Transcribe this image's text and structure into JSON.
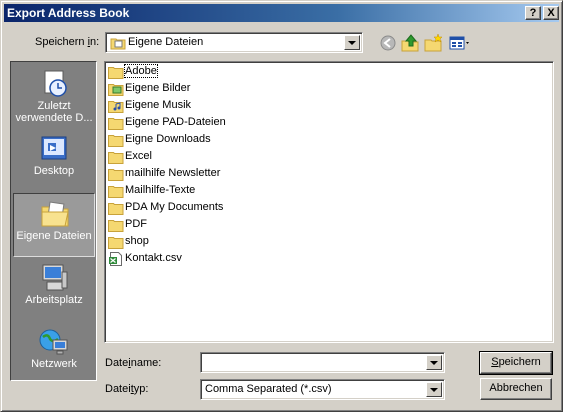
{
  "window": {
    "title": "Export Address Book"
  },
  "titlebar_buttons": {
    "help": "?",
    "close": "X"
  },
  "lookin": {
    "label_pre": "Speichern ",
    "label_u": "i",
    "label_post": "n:",
    "value": "Eigene Dateien"
  },
  "places": [
    {
      "id": "recent",
      "label": "Zuletzt verwendete D...",
      "icon": "recent-documents-icon"
    },
    {
      "id": "desktop",
      "label": "Desktop",
      "icon": "desktop-icon"
    },
    {
      "id": "mydocs",
      "label": "Eigene Dateien",
      "icon": "my-documents-icon",
      "active": true
    },
    {
      "id": "mycomputer",
      "label": "Arbeitsplatz",
      "icon": "my-computer-icon"
    },
    {
      "id": "network",
      "label": "Netzwerk",
      "icon": "network-icon"
    }
  ],
  "files": [
    {
      "name": "Adobe",
      "type": "folder"
    },
    {
      "name": "Eigene Bilder",
      "type": "folder-pictures"
    },
    {
      "name": "Eigene Musik",
      "type": "folder-music"
    },
    {
      "name": "Eigene PAD-Dateien",
      "type": "folder"
    },
    {
      "name": "Eigne Downloads",
      "type": "folder"
    },
    {
      "name": "Excel",
      "type": "folder"
    },
    {
      "name": "mailhilfe Newsletter",
      "type": "folder"
    },
    {
      "name": "Mailhilfe-Texte",
      "type": "folder"
    },
    {
      "name": "PDA My Documents",
      "type": "folder"
    },
    {
      "name": "PDF",
      "type": "folder"
    },
    {
      "name": "shop",
      "type": "folder"
    },
    {
      "name": "Kontakt.csv",
      "type": "csv"
    }
  ],
  "filename": {
    "label_pre": "Date",
    "label_u": "i",
    "label_post": "name:",
    "value": ""
  },
  "filetype": {
    "label_pre": "Datei",
    "label_u": "t",
    "label_post": "yp:",
    "value": "Comma Separated (*.csv)"
  },
  "buttons": {
    "save_u": "S",
    "save_rest": "peichern",
    "cancel": "Abbrechen"
  },
  "colors": {
    "folder": "#f5d871",
    "folder_dark": "#c8a23a",
    "titlebar": "#0a246a",
    "places_bg": "#808080"
  }
}
